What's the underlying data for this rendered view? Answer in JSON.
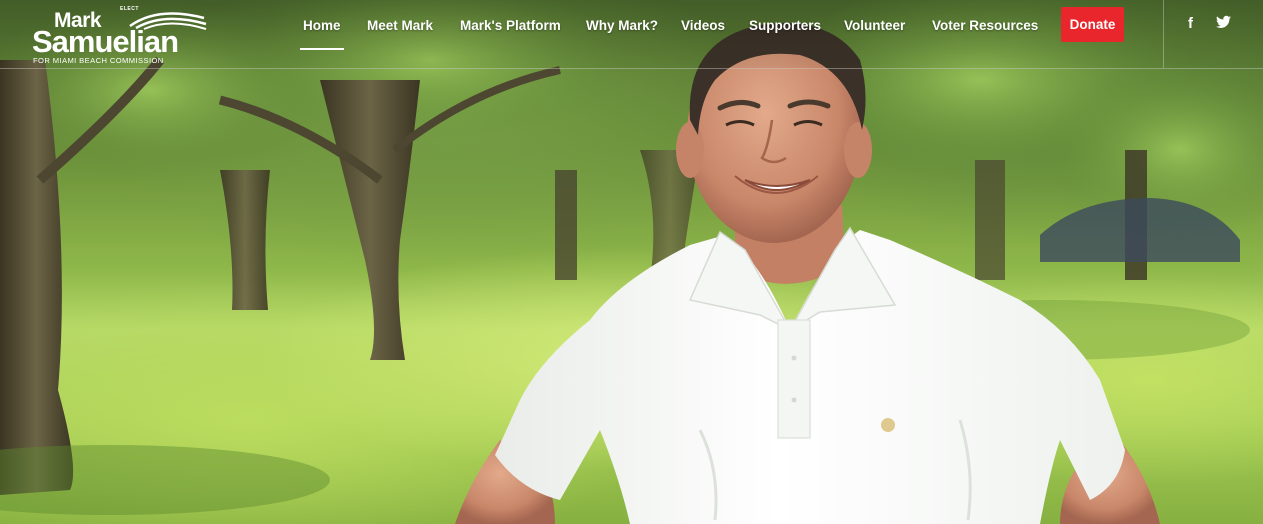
{
  "logo": {
    "elect": "ELECT",
    "first_name": "Mark",
    "last_name": "Samuelian",
    "tagline": "FOR MIAMI BEACH COMMISSION"
  },
  "nav": {
    "items": [
      {
        "label": "Home",
        "active": true
      },
      {
        "label": "Meet Mark"
      },
      {
        "label": "Mark's Platform"
      },
      {
        "label": "Why Mark?"
      },
      {
        "label": "Videos"
      },
      {
        "label": "Supporters"
      },
      {
        "label": "Volunteer"
      },
      {
        "label": "Voter Resources"
      }
    ],
    "donate_label": "Donate"
  },
  "social": {
    "facebook_icon": "facebook-icon",
    "facebook_glyph": "f",
    "twitter_icon": "twitter-icon"
  },
  "colors": {
    "donate": "#e8262b",
    "nav_text": "#ffffff"
  }
}
